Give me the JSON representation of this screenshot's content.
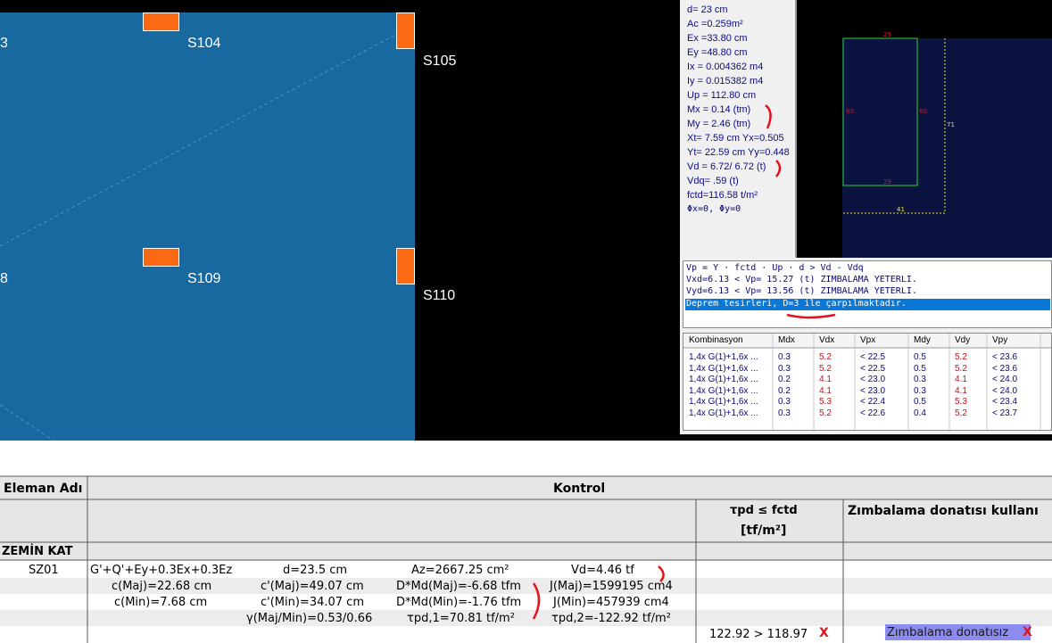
{
  "cad": {
    "columns": [
      "S104",
      "S105",
      "S109",
      "S110"
    ],
    "partial_labels": [
      "3",
      "8"
    ]
  },
  "info": {
    "lines": [
      "d= 23 cm",
      "Ac =0.259m²",
      "Ex =33.80 cm",
      "Ey =48.80 cm",
      "Ix = 0.004362 m4",
      "Iy = 0.015382 m4",
      "Up = 112.80 cm",
      "Mx = 0.14 (tm)",
      "My = 2.46 (tm)",
      "Xt= 7.59 cm Yx=0.505",
      "Yt= 22.59 cm Yy=0.448",
      "Vd = 6.72/ 6.72 (t)",
      "Vdq= .59 (t)",
      "fctd=116.58 t/m²",
      "Φx=0, Φy=0"
    ]
  },
  "section": {
    "dims": {
      "top": "29",
      "bottom": "29",
      "left": "60",
      "right": "60",
      "height": "71",
      "width": "41"
    }
  },
  "formula": {
    "lines": [
      "Vp = Y · fctd · Up · d  > Vd - Vdq",
      "Vxd=6.13 < Vp=  15.27 (t) ZIMBALAMA YETERLI.",
      "Vyd=6.13 < Vp=  13.56 (t) ZIMBALAMA YETERLI."
    ],
    "selected": "Deprem tesirleri, D=3 ile çarpılmaktadır."
  },
  "grid": {
    "headers": [
      "Kombinasyon",
      "Mdx",
      "Vdx",
      "Vpx",
      "Mdy",
      "Vdy",
      "Vpy"
    ],
    "rows": [
      [
        "1,4x G(1)+1,6x ...",
        "0.3",
        "5.2",
        "< 22.5",
        "0.5",
        "5.2",
        "< 23.6"
      ],
      [
        "1,4x G(1)+1,6x ...",
        "0.3",
        "5.2",
        "< 22.5",
        "0.5",
        "5.2",
        "< 23.6"
      ],
      [
        "1,4x G(1)+1,6x ...",
        "0.2",
        "4.1",
        "< 23.0",
        "0.3",
        "4.1",
        "< 24.0"
      ],
      [
        "1,4x G(1)+1,6x ...",
        "0.2",
        "4.1",
        "< 23.0",
        "0.3",
        "4.1",
        "< 24.0"
      ],
      [
        "1,4x G(1)+1,6x ...",
        "0.3",
        "5.3",
        "< 22.4",
        "0.5",
        "5.3",
        "< 23.4"
      ],
      [
        "1,4x G(1)+1,6x ...",
        "0.3",
        "5.2",
        "< 22.6",
        "0.4",
        "5.2",
        "< 23.7"
      ]
    ]
  },
  "report": {
    "header_element": "Eleman Adı",
    "header_control": "Kontrol",
    "header_tau": "τpd ≤ fctd",
    "header_tau_unit": "[tf/m²]",
    "header_zimb": "Zımbalama donatısı kullanı",
    "floor": "ZEMİN KAT",
    "element": "SZ01",
    "r1": {
      "combo": "G'+Q'+Ey+0.3Ex+0.3Ez",
      "d": "d=23.5 cm",
      "az": "Az=2667.25 cm²",
      "vd": "Vd=4.46 tf"
    },
    "r2": {
      "c": "c(Maj)=22.68 cm",
      "cp": "c'(Maj)=49.07 cm",
      "dmd": "D*Md(Maj)=-6.68 tfm",
      "j": "J(Maj)=1599195 cm4"
    },
    "r3": {
      "c": "c(Min)=7.68 cm",
      "cp": "c'(Min)=34.07 cm",
      "dmd": "D*Md(Min)=-1.76 tfm",
      "j": "J(Min)=457939 cm4"
    },
    "r4": {
      "gamma": "γ(Maj/Min)=0.53/0.66",
      "tpd1": "τpd,1=70.81 tf/m²",
      "tpd2": "τpd,2=-122.92 tf/m²",
      "check": "122.92 > 118.97",
      "result": "Zımbalama donatısız"
    },
    "fail_mark": "X"
  }
}
